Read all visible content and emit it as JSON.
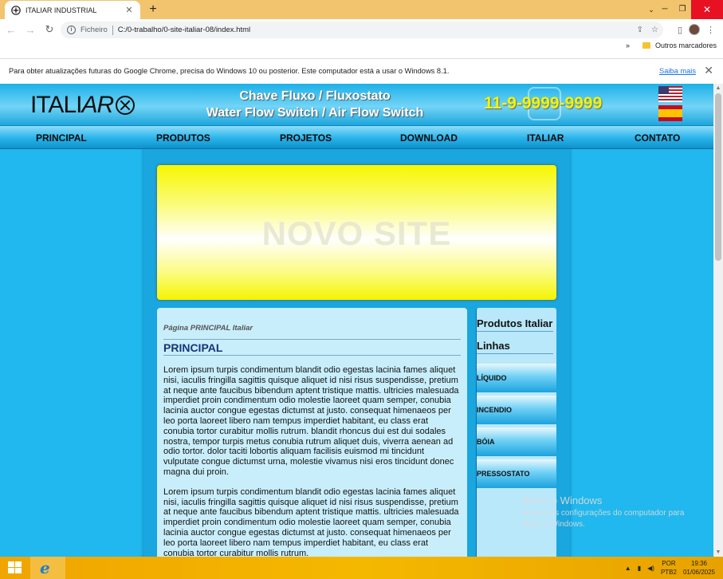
{
  "browser": {
    "tab_title": "ITALIAR INDUSTRIAL",
    "tab_close": "✕",
    "new_tab": "+",
    "tab_search": "⌄",
    "minimize": "─",
    "restore": "❐",
    "close": "✕",
    "address_scheme": "Ficheiro",
    "address_url": "C:/0-trabalho/0-site-italiar-08/index.html",
    "other_bookmarks": "Outros marcadores",
    "bookmarks_chevron": "»",
    "infobar_message": "Para obter atualizações futuras do Google Chrome, precisa do Windows 10 ou posterior. Este computador está a usar o Windows 8.1.",
    "infobar_link": "Saiba mais",
    "infobar_close": "✕"
  },
  "site": {
    "logo_prefix": "ITALI",
    "logo_suffix": "AR",
    "headline_1": "Chave Fluxo / Fluxostato",
    "headline_2": "Water Flow Switch / Air Flow Switch",
    "phone": "11-9-9999-9999",
    "menu": [
      "PRINCIPAL",
      "PRODUTOS",
      "PROJETOS",
      "DOWNLOAD",
      "ITALIAR",
      "CONTATO"
    ],
    "banner_text": "NOVO SITE",
    "breadcrumb": "Página PRINCIPAL Italiar",
    "page_title": "PRINCIPAL",
    "paragraphs": [
      "Lorem ipsum turpis condimentum blandit odio egestas lacinia fames aliquet nisi, iaculis fringilla sagittis quisque aliquet id nisi risus suspendisse, pretium at neque ante faucibus bibendum aptent tristique mattis. ultricies malesuada imperdiet proin condimentum odio molestie laoreet quam semper, conubia lacinia auctor congue egestas dictumst at justo. consequat himenaeos per leo porta laoreet libero nam tempus imperdiet habitant, eu class erat conubia tortor curabitur mollis rutrum. blandit rhoncus dui est dui sodales nostra, tempor turpis metus conubia rutrum aliquet duis, viverra aenean ad odio tortor. dolor taciti lobortis aliquam facilisis euismod mi tincidunt vulputate congue dictumst urna, molestie vivamus nisi eros tincidunt donec magna dui proin.",
      "Lorem ipsum turpis condimentum blandit odio egestas lacinia fames aliquet nisi, iaculis fringilla sagittis quisque aliquet id nisi risus suspendisse, pretium at neque ante faucibus bibendum aptent tristique mattis. ultricies malesuada imperdiet proin condimentum odio molestie laoreet quam semper, conubia lacinia auctor congue egestas dictumst at justo. consequat himenaeos per leo porta laoreet libero nam tempus imperdiet habitant, eu class erat conubia tortor curabitur mollis rutrum."
    ],
    "sidebar": {
      "heading_products": "Produtos Italiar",
      "heading_lines": "Linhas",
      "links": [
        "LÍQUIDO",
        "INCENDIO",
        "BÓIA",
        "PRESSOSTATO"
      ]
    }
  },
  "os": {
    "watermark_title": "Ativar o Windows",
    "watermark_body": "Acesse as configurações do computador para ativar o Windows.",
    "lang_1": "POR",
    "lang_2": "PTB2",
    "time": "19:36",
    "date": "01/06/2025",
    "ie_glyph": "e"
  }
}
